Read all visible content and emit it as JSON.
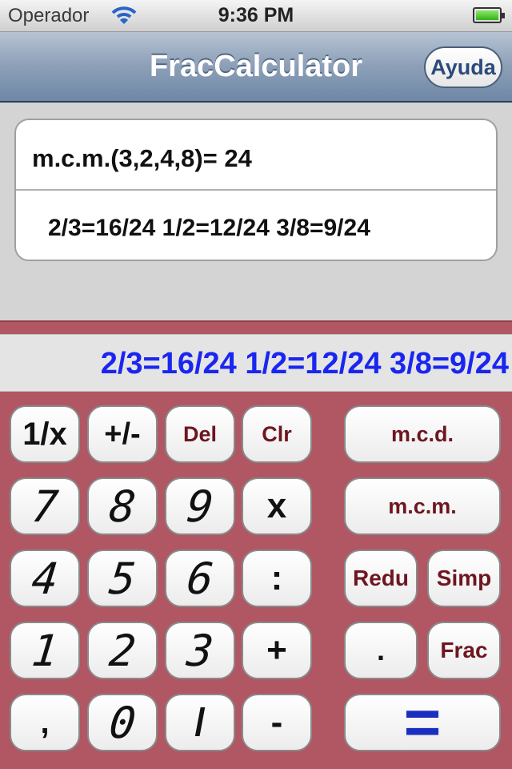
{
  "status_bar": {
    "carrier": "Operador",
    "time": "9:36 PM",
    "battery_level": 1.0
  },
  "nav": {
    "title": "FracCalculator",
    "help_label": "Ayuda"
  },
  "results": {
    "lcm_line": "m.c.m.(3,2,4,8)= 24",
    "equivalents_line": "2/3=16/24 1/2=12/24 3/8=9/24"
  },
  "display": {
    "text": "2/3=16/24 1/2=12/24 3/8=9/24"
  },
  "keys": {
    "reciprocal": "1/x",
    "plusminus": "+/-",
    "del": "Del",
    "clr": "Clr",
    "mcd": "m.c.d.",
    "d7": "7",
    "d8": "8",
    "d9": "9",
    "mul": "x",
    "mcm": "m.c.m.",
    "d4": "4",
    "d5": "5",
    "d6": "6",
    "div": ":",
    "redu": "Redu",
    "simp": "Simp",
    "d1": "1",
    "d2": "2",
    "d3": "3",
    "add": "+",
    "dot": ".",
    "frac": "Frac",
    "comma": ",",
    "d0": "0",
    "slash": "/",
    "sub": "-",
    "equals": "="
  },
  "colors": {
    "panel": "#b05763",
    "display_text": "#1a26f0",
    "accent_text": "#6e1620",
    "equals": "#1a2fc0"
  }
}
